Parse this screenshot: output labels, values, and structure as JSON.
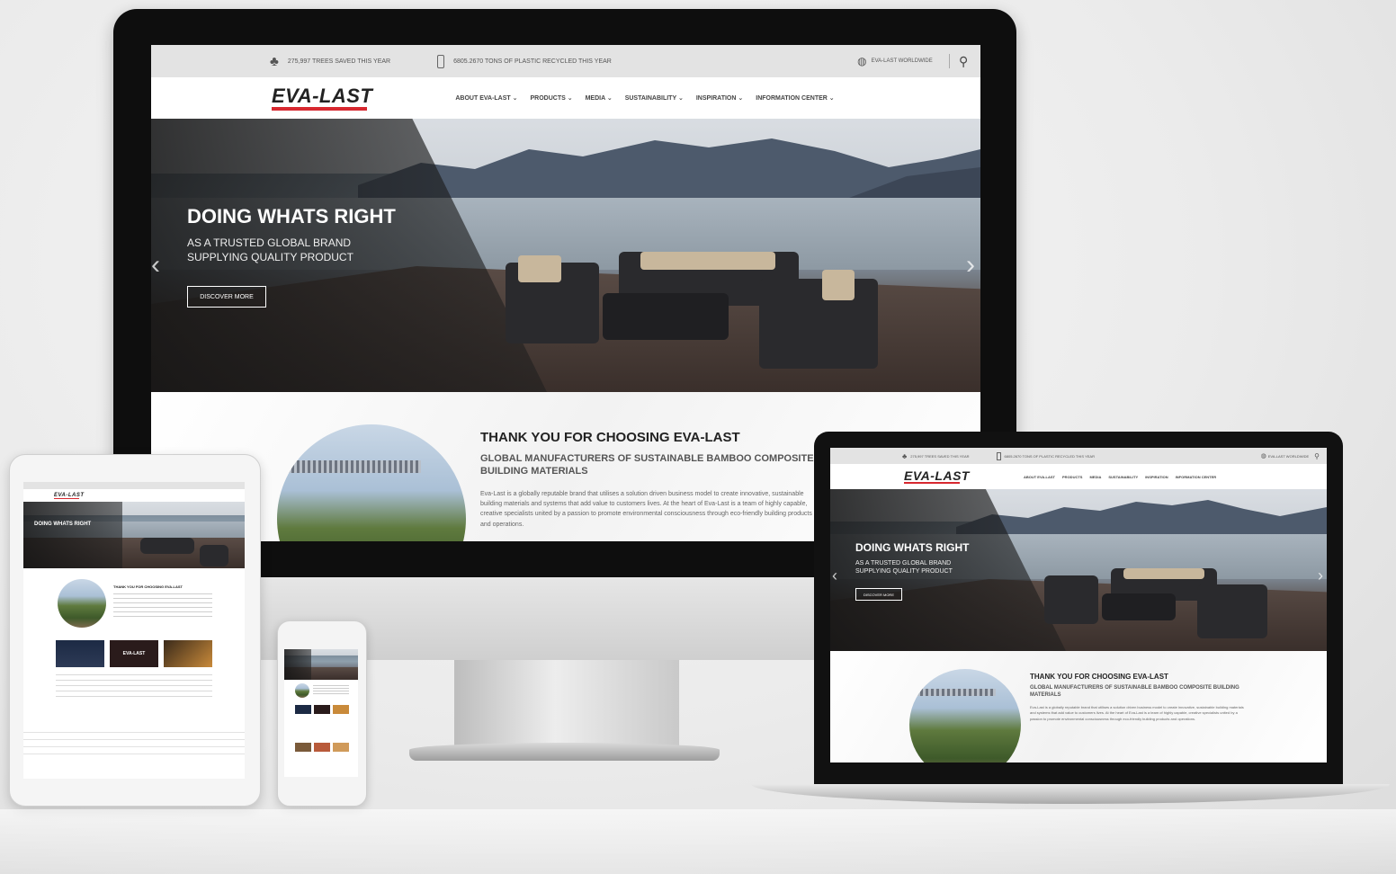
{
  "site": {
    "trees_stat": "275,997 TREES SAVED THIS YEAR",
    "plastic_stat": "6805.2670 TONS OF PLASTIC RECYCLED THIS YEAR",
    "region": "EVA-LAST WORLDWIDE",
    "logo": "EVA-LAST",
    "nav": [
      "ABOUT EVA-LAST",
      "PRODUCTS",
      "MEDIA",
      "SUSTAINABILITY",
      "INSPIRATION",
      "INFORMATION CENTER"
    ],
    "hero": {
      "title": "DOING WHATS RIGHT",
      "subtitle_line1": "AS A TRUSTED GLOBAL BRAND",
      "subtitle_line2": "SUPPLYING QUALITY PRODUCT",
      "button": "DISCOVER MORE"
    },
    "intro": {
      "title": "THANK YOU FOR CHOOSING EVA-LAST",
      "subtitle": "GLOBAL MANUFACTURERS OF SUSTAINABLE BAMBOO COMPOSITE BUILDING MATERIALS",
      "body": "Eva-Last is a globally reputable brand that utilises a solution driven business model to create innovative, sustainable building materials and systems that add value to customers lives. At the heart of Eva-Last is a team of highly capable, creative specialists united by a passion to promote environmental consciousness through eco-friendly building products and operations."
    }
  },
  "colors": {
    "brand_red": "#d7282f",
    "topbar_gray": "#e3e3e3",
    "device_black": "#111111",
    "silver": "#cfcfcf"
  },
  "icons": {
    "tree": "tree-icon",
    "bottle": "bottle-icon",
    "globe": "globe-icon",
    "search": "search-icon",
    "prev": "chevron-left-icon",
    "next": "chevron-right-icon",
    "dropdown": "chevron-down-icon"
  }
}
